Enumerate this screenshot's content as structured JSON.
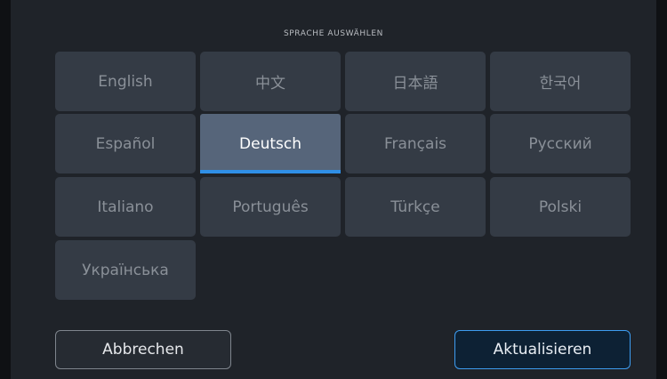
{
  "dialog": {
    "title": "SPRACHE AUSWÄHLEN",
    "selected_language": "Deutsch"
  },
  "languages": [
    {
      "label": "English",
      "selected": false
    },
    {
      "label": "中文",
      "selected": false
    },
    {
      "label": "日本語",
      "selected": false
    },
    {
      "label": "한국어",
      "selected": false
    },
    {
      "label": "Español",
      "selected": false
    },
    {
      "label": "Deutsch",
      "selected": true
    },
    {
      "label": "Français",
      "selected": false
    },
    {
      "label": "Русский",
      "selected": false
    },
    {
      "label": "Italiano",
      "selected": false
    },
    {
      "label": "Português",
      "selected": false
    },
    {
      "label": "Türkçe",
      "selected": false
    },
    {
      "label": "Polski",
      "selected": false
    },
    {
      "label": "Українська",
      "selected": false
    }
  ],
  "buttons": {
    "cancel_label": "Abbrechen",
    "update_label": "Aktualisieren"
  },
  "colors": {
    "accent": "#2f8fe6",
    "tile": "#343b45",
    "tile_selected": "#56657a",
    "background": "#1f2329"
  }
}
